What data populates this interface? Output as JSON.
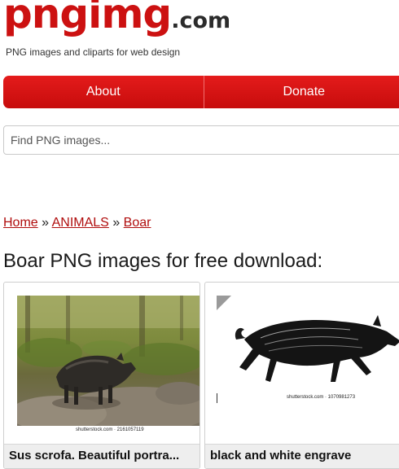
{
  "site": {
    "logo_main": "pngimg",
    "logo_tld": ".com",
    "tagline": "PNG images and cliparts for web design"
  },
  "nav": {
    "about": "About",
    "donate": "Donate"
  },
  "search": {
    "placeholder": "Find PNG images..."
  },
  "breadcrumb": {
    "home": "Home",
    "sep1": "»",
    "category": "ANIMALS",
    "sep2": "»",
    "current": "Boar"
  },
  "heading": "Boar PNG images for free download:",
  "cards": [
    {
      "caption": "Sus scrofa. Beautiful portra...",
      "watermark": "shutterstock.com · 2161057119"
    },
    {
      "caption": "black and white engrave",
      "watermark": "shutterstock.com · 1070981273"
    }
  ]
}
